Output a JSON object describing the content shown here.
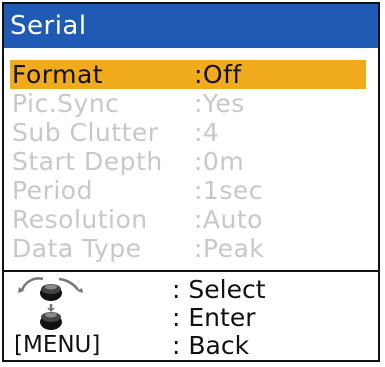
{
  "window": {
    "title": "Serial"
  },
  "menu": {
    "items": [
      {
        "label": "Format",
        "value": ":Off",
        "selected": true
      },
      {
        "label": "Pic.Sync",
        "value": ":Yes",
        "selected": false
      },
      {
        "label": "Sub Clutter",
        "value": ":4",
        "selected": false
      },
      {
        "label": "Start Depth",
        "value": ":0m",
        "selected": false
      },
      {
        "label": "Period",
        "value": ":1sec",
        "selected": false
      },
      {
        "label": "Resolution",
        "value": ":Auto",
        "selected": false
      },
      {
        "label": "Data Type",
        "value": ":Peak",
        "selected": false
      }
    ]
  },
  "help": {
    "rows": [
      {
        "icon": "rotary-knob-icon",
        "action": ": Select"
      },
      {
        "icon": "push-knob-icon",
        "action": ": Enter"
      },
      {
        "key": "[MENU]",
        "action": ": Back"
      }
    ]
  },
  "colors": {
    "title_bar": "#1f5bb4",
    "selection": "#efab1b",
    "inactive_text": "#c8c8c8",
    "text": "#111111"
  }
}
